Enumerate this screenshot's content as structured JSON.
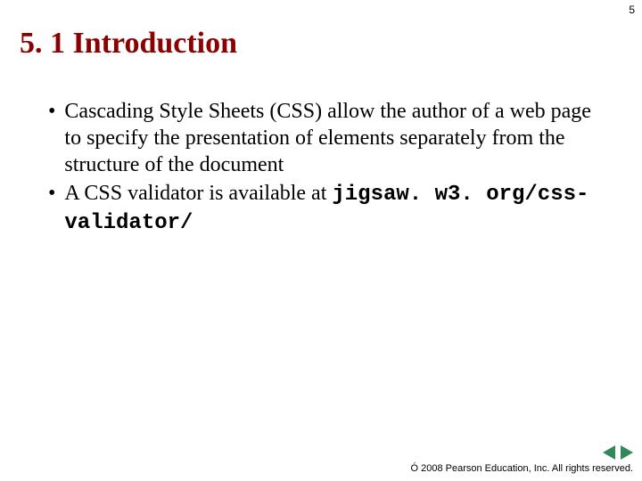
{
  "page_number": "5",
  "title": "5. 1 Introduction",
  "bullets": [
    {
      "text": "Cascading Style Sheets (CSS) allow the author of a web page to specify the presentation of elements separately from the structure of the document"
    },
    {
      "text_prefix": "A CSS validator is available at ",
      "mono_text": "jigsaw. w3. org/css-validator/"
    }
  ],
  "copyright": "Ó 2008 Pearson Education, Inc. All rights reserved."
}
